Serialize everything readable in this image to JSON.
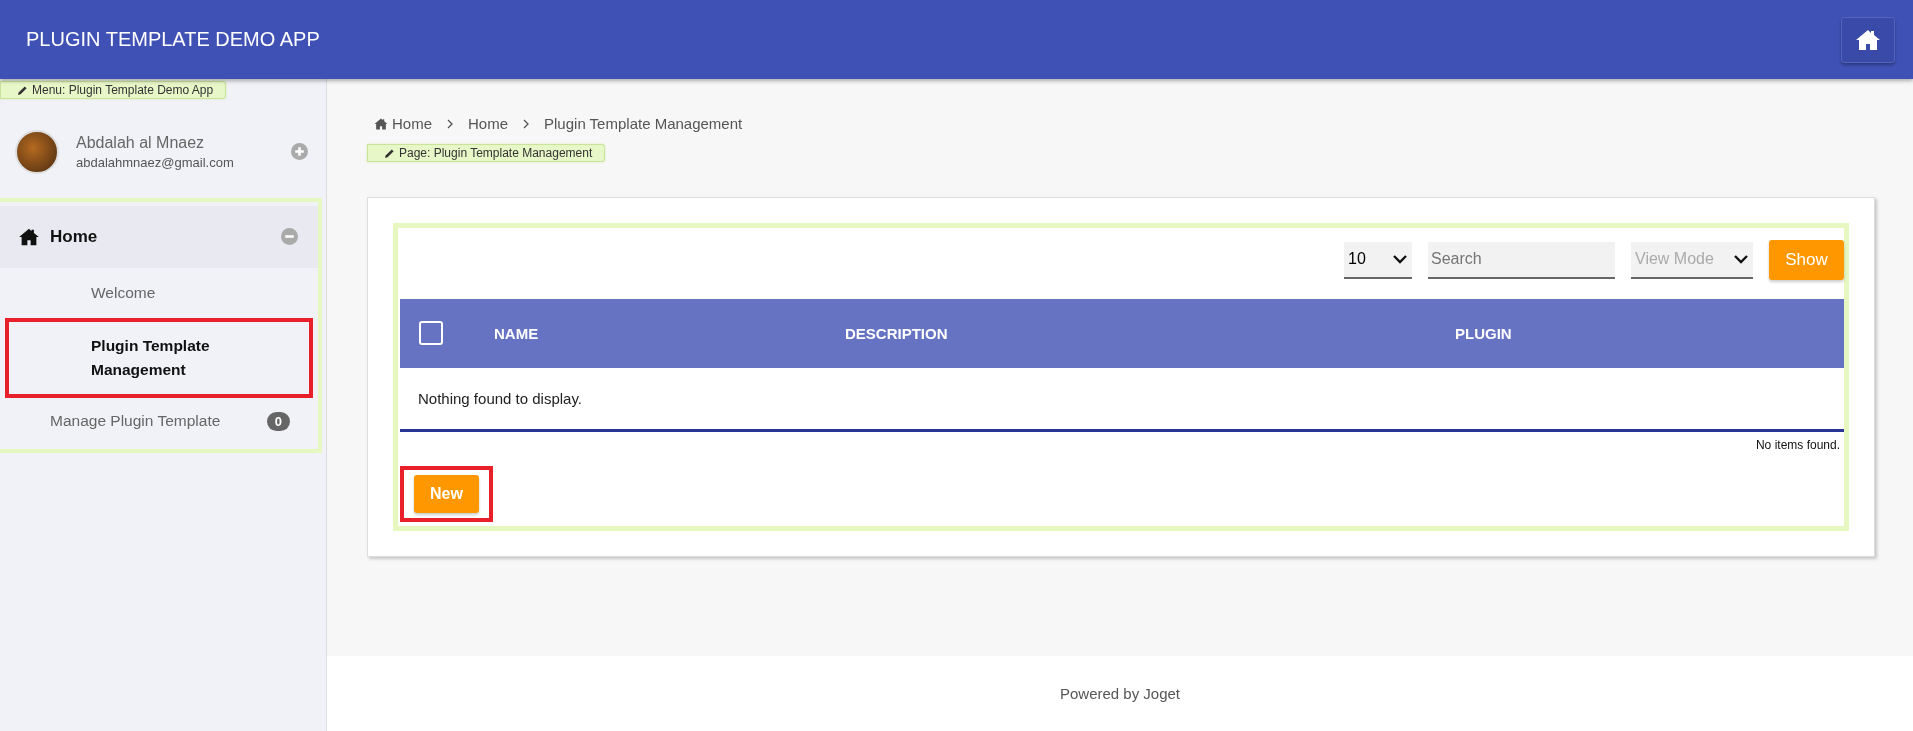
{
  "header": {
    "title": "PLUGIN TEMPLATE DEMO APP"
  },
  "sidebar": {
    "menu_tag": "Menu: Plugin Template Demo App",
    "user": {
      "name": "Abdalah al Mnaez",
      "email": "abdalahmnaez@gmail.com"
    },
    "category": {
      "label": "Home",
      "expanded": true
    },
    "items": [
      {
        "label": "Welcome",
        "selected": false,
        "highlighted": false
      },
      {
        "label": "Plugin Template Management",
        "selected": true,
        "highlighted": true
      }
    ],
    "manage": {
      "label": "Manage Plugin Template",
      "count": "0"
    }
  },
  "breadcrumb": [
    "Home",
    "Home",
    "Plugin Template Management"
  ],
  "page_tag": "Page: Plugin Template Management",
  "toolbar": {
    "page_size": "10",
    "search_placeholder": "Search",
    "view_mode_placeholder": "View Mode",
    "show_button": "Show"
  },
  "table": {
    "select_all_checked": false,
    "columns": [
      "NAME",
      "DESCRIPTION",
      "PLUGIN"
    ],
    "empty_message": "Nothing found to display.",
    "status": "No items found."
  },
  "new_button": {
    "label": "New",
    "highlighted": true
  },
  "footer": "Powered by Joget"
}
